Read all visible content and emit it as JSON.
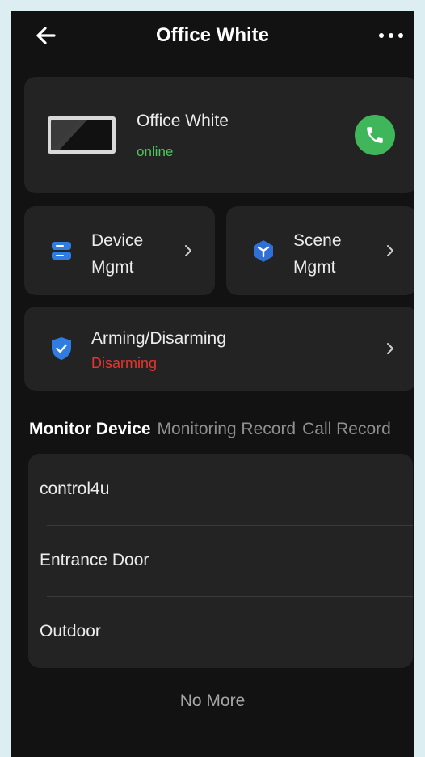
{
  "header": {
    "title": "Office White",
    "back_icon": "arrow-left-icon",
    "more_icon": "more-dots-icon"
  },
  "device": {
    "name": "Office White",
    "status": "online",
    "status_color": "#4cc65a",
    "call_icon": "phone-icon",
    "call_color": "#3fb65a"
  },
  "actions": [
    {
      "label_line1": "Device",
      "label_line2": "Mgmt",
      "icon": "storage-icon"
    },
    {
      "label_line1": "Scene",
      "label_line2": "Mgmt",
      "icon": "scene-cube-icon"
    }
  ],
  "arming": {
    "title": "Arming/Disarming",
    "status": "Disarming",
    "status_color": "#e8352e",
    "icon": "shield-check-icon"
  },
  "tabs": [
    {
      "label": "Monitor Device",
      "active": true
    },
    {
      "label": "Monitoring Record",
      "active": false
    },
    {
      "label": "Call Record",
      "active": false
    }
  ],
  "monitor_devices": [
    {
      "name": "control4u"
    },
    {
      "name": "Entrance Door"
    },
    {
      "name": "Outdoor"
    }
  ],
  "footer": {
    "text": "No More"
  },
  "colors": {
    "accent_blue": "#2f7de1",
    "background": "#121212",
    "card": "#232323"
  }
}
